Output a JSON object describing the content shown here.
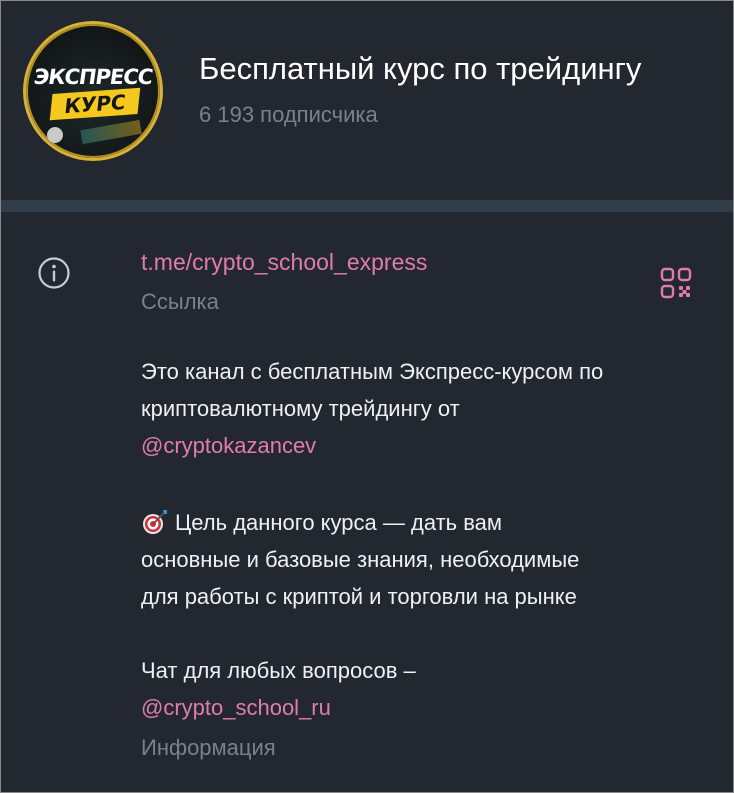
{
  "channel": {
    "avatar": {
      "line1": "ЭКСПРЕСС",
      "line2": "КУРС"
    },
    "title": "Бесплатный курс по трейдингу",
    "subscribers": "6 193 подписчика"
  },
  "info": {
    "link": "t.me/crypto_school_express",
    "link_caption": "Ссылка",
    "description": {
      "p1_line1": "Это канал с бесплатным Экспресс-курсом по",
      "p1_line2": "криптовалютному трейдингу от",
      "p1_mention": "@cryptokazancev",
      "p2_line1": "Цель данного курса — дать вам",
      "p2_line2": "основные и базовые знания, необходимые",
      "p2_line3": "для работы с криптой и торговли на рынке",
      "p3_line1": "Чат для любых вопросов –",
      "p3_mention": "@crypto_school_ru"
    },
    "description_caption": "Информация"
  },
  "colors": {
    "background": "#232830",
    "divider": "#313d48",
    "accent": "#e07da6",
    "muted": "#79818b",
    "text": "#eef1f4"
  },
  "icons": {
    "info": "info-circle-icon",
    "qr": "qr-code-icon",
    "target": "target-dart-icon"
  }
}
